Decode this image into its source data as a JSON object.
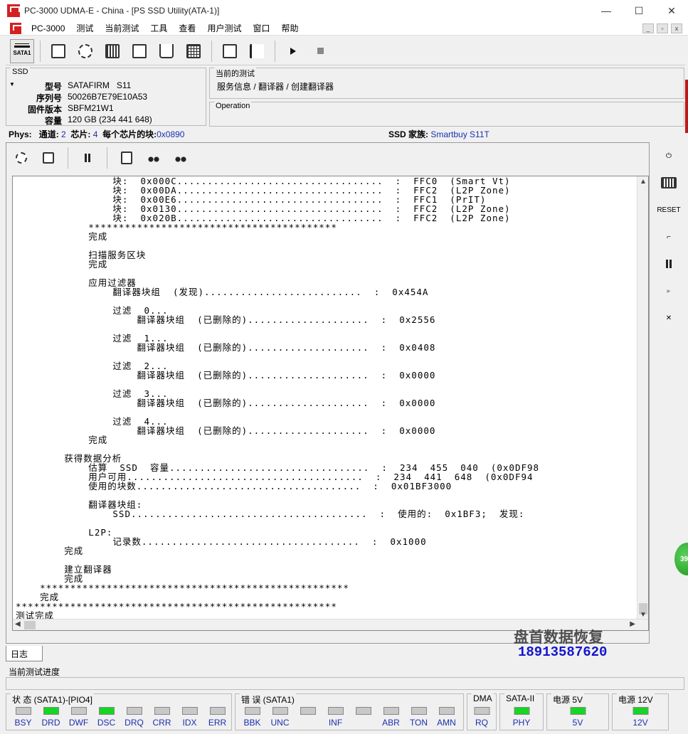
{
  "window": {
    "title": "PC-3000 UDMA-E - China - [PS SSD Utility(ATA-1)]",
    "min": "—",
    "max": "☐",
    "close": "✕"
  },
  "menu": [
    "PC-3000",
    "测试",
    "当前测试",
    "工具",
    "查看",
    "用户测试",
    "窗口",
    "帮助"
  ],
  "toolbar": {
    "sata_label": "SATA1"
  },
  "ssd": {
    "legend": "SSD",
    "model_label": "型号",
    "model": "SATAFIRM   S11",
    "serial_label": "序列号",
    "serial": "50026B7E79E10A53",
    "firmware_label": "固件版本",
    "firmware": "SBFM21W1",
    "capacity_label": "容量",
    "capacity": "120 GB (234 441 648)"
  },
  "current_test": {
    "legend": "当前的测试",
    "path": "服务信息 / 翻译器 / 创建翻译器"
  },
  "operation": {
    "legend": "Operation"
  },
  "phys": {
    "label": "Phys:",
    "channel_label": "通道:",
    "channel": "2",
    "chips_label": "芯片:",
    "chips": "4",
    "blocks_label": "每个芯片的块:",
    "blocks": "0x0890",
    "family_label": "SSD 家族:",
    "family": "Smartbuy S11T"
  },
  "log_lines": [
    "                块:  0x000C..................................  :  FFC0  (Smart Vt)",
    "                块:  0x00DA..................................  :  FFC2  (L2P Zone)",
    "                块:  0x00E6..................................  :  FFC1  (PrIT)",
    "                块:  0x0130..................................  :  FFC2  (L2P Zone)",
    "                块:  0x020B..................................  :  FFC2  (L2P Zone)",
    "            *****************************************",
    "            完成",
    "",
    "            扫描服务区块",
    "            完成",
    "",
    "            应用过滤器",
    "                翻译器块组  (发现)..........................  :  0x454A",
    "",
    "                过滤  0...",
    "                    翻译器块组  (已删除的)....................  :  0x2556",
    "",
    "                过滤  1...",
    "                    翻译器块组  (已删除的)....................  :  0x0408",
    "",
    "                过滤  2...",
    "                    翻译器块组  (已删除的)....................  :  0x0000",
    "",
    "                过滤  3...",
    "                    翻译器块组  (已删除的)....................  :  0x0000",
    "",
    "                过滤  4...",
    "                    翻译器块组  (已删除的)....................  :  0x0000",
    "            完成",
    "",
    "        获得数据分析",
    "            估算  SSD  容量.................................  :  234  455  040  (0x0DF98",
    "            用户可用.......................................  :  234  441  648  (0x0DF94",
    "            使用的块数.....................................  :  0x01BF3000",
    "",
    "            翻译器块组:",
    "                SSD.......................................  :  使用的:  0x1BF3;  发现:",
    "",
    "            L2P:",
    "                记录数....................................  :  0x1000",
    "        完成",
    "",
    "        建立翻译器",
    "        完成",
    "    ***************************************************",
    "    完成",
    "*****************************************************",
    "测试完成"
  ],
  "tab_label": "日志",
  "progress": {
    "label": "当前测试进度",
    "value": 0
  },
  "status_groups": [
    {
      "legend": "状 态 (SATA1)-[PIO4]",
      "leds": [
        {
          "label": "BSY",
          "on": false
        },
        {
          "label": "DRD",
          "on": true
        },
        {
          "label": "DWF",
          "on": false
        },
        {
          "label": "DSC",
          "on": true
        },
        {
          "label": "DRQ",
          "on": false
        },
        {
          "label": "CRR",
          "on": false
        },
        {
          "label": "IDX",
          "on": false
        },
        {
          "label": "ERR",
          "on": false
        }
      ]
    },
    {
      "legend": "错 误 (SATA1)",
      "leds": [
        {
          "label": "BBK",
          "on": false
        },
        {
          "label": "UNC",
          "on": false
        },
        {
          "label": "",
          "on": false
        },
        {
          "label": "INF",
          "on": false
        },
        {
          "label": "",
          "on": false
        },
        {
          "label": "ABR",
          "on": false
        },
        {
          "label": "TON",
          "on": false
        },
        {
          "label": "AMN",
          "on": false
        }
      ]
    },
    {
      "legend": "DMA",
      "leds": [
        {
          "label": "RQ",
          "on": false
        }
      ]
    },
    {
      "legend": "SATA-II",
      "leds": [
        {
          "label": "PHY",
          "on": true
        }
      ]
    },
    {
      "legend": "电源 5V",
      "leds": [
        {
          "label": "5V",
          "on": true
        }
      ]
    },
    {
      "legend": "电源 12V",
      "leds": [
        {
          "label": "12V",
          "on": true
        }
      ]
    }
  ],
  "watermark": {
    "line1": "盘首数据恢复",
    "line2": "18913587620"
  },
  "badge": "39",
  "sidebar_reset": "RESET",
  "colors": {
    "led_on": "#16d624",
    "link_blue": "#1a2fb0"
  }
}
